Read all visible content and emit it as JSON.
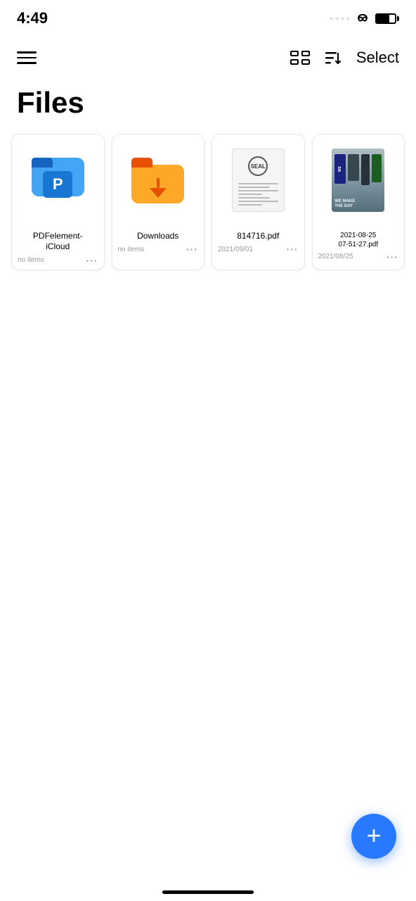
{
  "statusBar": {
    "time": "4:49",
    "battery": 70
  },
  "header": {
    "selectLabel": "Select"
  },
  "pageTitle": "Files",
  "files": [
    {
      "id": "pdfelement-icloud",
      "name": "PDFelement-\niCloud",
      "nameDisplay": "PDFelement-\niCloud",
      "type": "folder-blue",
      "date": "",
      "dateLabel": "no items"
    },
    {
      "id": "downloads",
      "name": "Downloads",
      "nameDisplay": "Downloads",
      "type": "folder-orange",
      "date": "",
      "dateLabel": "no items"
    },
    {
      "id": "814716-pdf",
      "name": "814716.pdf",
      "nameDisplay": "814716.pdf",
      "type": "pdf",
      "date": "2021/09/01",
      "dateLabel": "2021/09/01"
    },
    {
      "id": "2021-08-25-pdf",
      "name": "2021-08-25\n07-51-27.pdf",
      "nameDisplay": "2021-08-25 07-51-27.pdf",
      "type": "photo-pdf",
      "date": "2021/08/25",
      "dateLabel": "2021/08/25"
    }
  ],
  "fab": {
    "label": "+"
  }
}
